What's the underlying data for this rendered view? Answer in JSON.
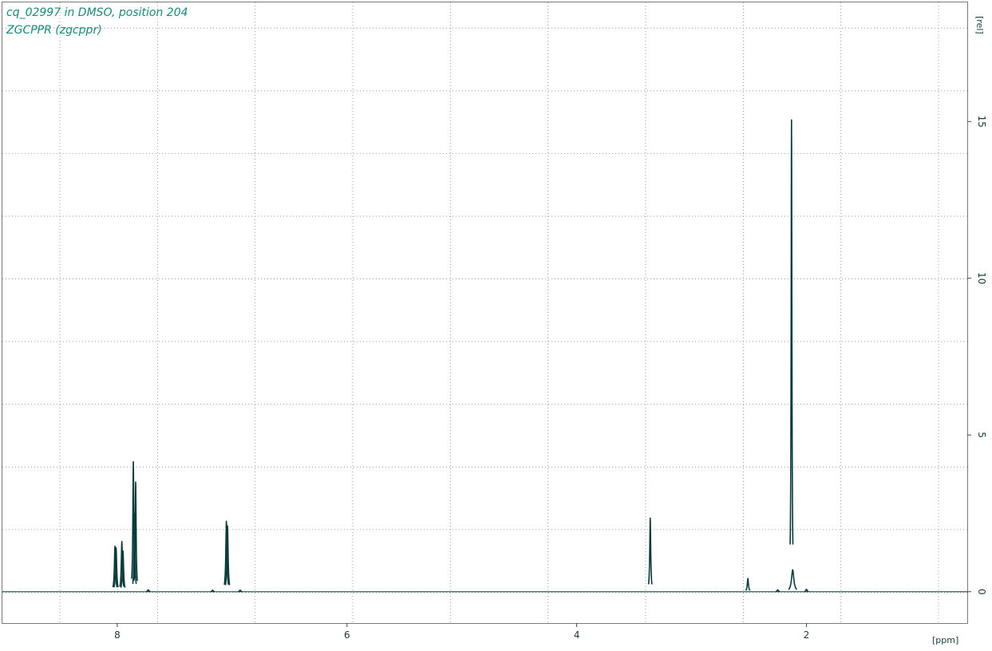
{
  "chart_data": {
    "type": "line",
    "title_lines": [
      "cq_02997 in DMSO, position 204",
      "ZGCPPR (zgcppr)"
    ],
    "xlabel": "[ppm]",
    "ylabel": "[rel]",
    "x_reversed": true,
    "xlim": [
      9.0,
      0.6
    ],
    "ylim": [
      -1.0,
      18.8
    ],
    "x_ticks": [
      8,
      6,
      4,
      2
    ],
    "x_tick_labels": [
      "8",
      "6",
      "4",
      "2"
    ],
    "y_ticks": [
      0,
      5,
      10,
      15
    ],
    "y_tick_labels": [
      "0",
      "5",
      "10",
      "15"
    ],
    "x_grid": [
      8.5,
      7.65,
      6.8,
      5.95,
      5.1,
      4.25,
      3.4,
      2.55,
      1.7,
      0.85
    ],
    "y_grid": [
      -0.02,
      1.98,
      3.98,
      5.98,
      7.98,
      9.98,
      11.98,
      13.98,
      15.98,
      17.98
    ],
    "grid": true,
    "series": [
      {
        "color": "#0a3a3a",
        "peaks": [
          {
            "x": 8.02,
            "y": 1.45,
            "w": 0.006
          },
          {
            "x": 8.01,
            "y": 1.4,
            "w": 0.006
          },
          {
            "x": 7.96,
            "y": 1.6,
            "w": 0.006
          },
          {
            "x": 7.95,
            "y": 1.3,
            "w": 0.006
          },
          {
            "x": 7.86,
            "y": 4.15,
            "w": 0.005
          },
          {
            "x": 7.85,
            "y": 2.5,
            "w": 0.005
          },
          {
            "x": 7.84,
            "y": 3.5,
            "w": 0.005
          },
          {
            "x": 7.05,
            "y": 2.25,
            "w": 0.006
          },
          {
            "x": 7.04,
            "y": 2.1,
            "w": 0.006
          },
          {
            "x": 7.73,
            "y": 0.06,
            "w": 0.006
          },
          {
            "x": 7.17,
            "y": 0.05,
            "w": 0.006
          },
          {
            "x": 6.93,
            "y": 0.05,
            "w": 0.006
          },
          {
            "x": 3.36,
            "y": 2.35,
            "w": 0.005
          },
          {
            "x": 2.51,
            "y": 0.42,
            "w": 0.006
          },
          {
            "x": 2.25,
            "y": 0.06,
            "w": 0.006
          },
          {
            "x": 2.13,
            "y": 15.05,
            "w": 0.004
          },
          {
            "x": 2.12,
            "y": 0.7,
            "w": 0.012
          },
          {
            "x": 2.0,
            "y": 0.08,
            "w": 0.006
          }
        ]
      }
    ]
  }
}
